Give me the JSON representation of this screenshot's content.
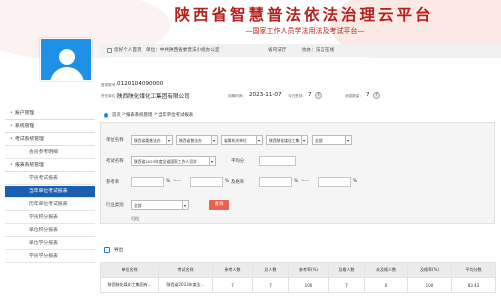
{
  "banner": {
    "title": "陕西省智慧普法依法治理云平台",
    "subtitle": "—国家工作人员学法用法及考试平台—"
  },
  "strip": {
    "portal_label": "您好个人首页",
    "unit_label": "单位：中共陕西省委普法小组办公室",
    "province_label": "省司法厅",
    "assist_label": "协办：法言在线"
  },
  "user": {
    "login_label": "登录账号：",
    "login_value": "0120104090000",
    "org_label": "所在单位：",
    "org_value": "陕西陕化煤化工集团有限公司",
    "time_label": "到期时间：",
    "time_value": "2023-11-07",
    "checkin_label": "今日签到：",
    "checkin_count": "7",
    "messages_label": "消息数量：",
    "messages_count": "7"
  },
  "sidebar": {
    "items": [
      {
        "label": "账户管理",
        "type": "top"
      },
      {
        "label": "系统管理",
        "type": "top"
      },
      {
        "label": "考试系统管理",
        "type": "top"
      },
      {
        "label": "会员参考明细",
        "type": "sub"
      },
      {
        "label": "报表系统管理",
        "type": "top"
      },
      {
        "label": "学员考试报表",
        "type": "sub"
      },
      {
        "label": "当年单位考试报表",
        "type": "sub",
        "active": true
      },
      {
        "label": "历年单位考试报表",
        "type": "sub"
      },
      {
        "label": "学员积分报表",
        "type": "sub"
      },
      {
        "label": "单位积分报表",
        "type": "sub"
      },
      {
        "label": "单位学分报表",
        "type": "sub"
      },
      {
        "label": "学员学分报表",
        "type": "sub"
      }
    ]
  },
  "breadcrumb": {
    "home": "首页",
    "sep1": ">",
    "section": "报表系统管理",
    "sep2": ">",
    "page": "当年单位考试报表"
  },
  "filters": {
    "unit_label": "单位名称",
    "unit_sel_1": "陕西省委普法办",
    "unit_sel_2": "陕西省普法办",
    "unit_sel_3": "省属机关单位",
    "unit_sel_4": "陕西陕化煤化工集",
    "unit_sel_5": "全部",
    "exam_label": "考试名称",
    "exam_value": "陕西省2023年度全省国家工作人员学",
    "avg_label": "平均分",
    "part_label": "参考率",
    "part_from": "",
    "part_to": "",
    "part_sep": "-----",
    "pct": "%",
    "pass_label": "及格率",
    "pass_from": "",
    "pass_to": "",
    "industry_label": "行业类别",
    "industry_value": "全部",
    "search_button": "查询",
    "reset_link": "归档"
  },
  "export": {
    "label": "导出"
  },
  "table": {
    "headers": [
      "单位名称",
      "考试名称",
      "参考人数",
      "总人数",
      "参考率(%)",
      "及格人数",
      "未及格人数",
      "及格率(%)",
      "平均分数"
    ],
    "rows": [
      [
        "陕西陕化煤化工集团有...",
        "陕西省2023年度全...",
        "7",
        "7",
        "100",
        "7",
        "0",
        "100",
        "83.43"
      ]
    ]
  }
}
